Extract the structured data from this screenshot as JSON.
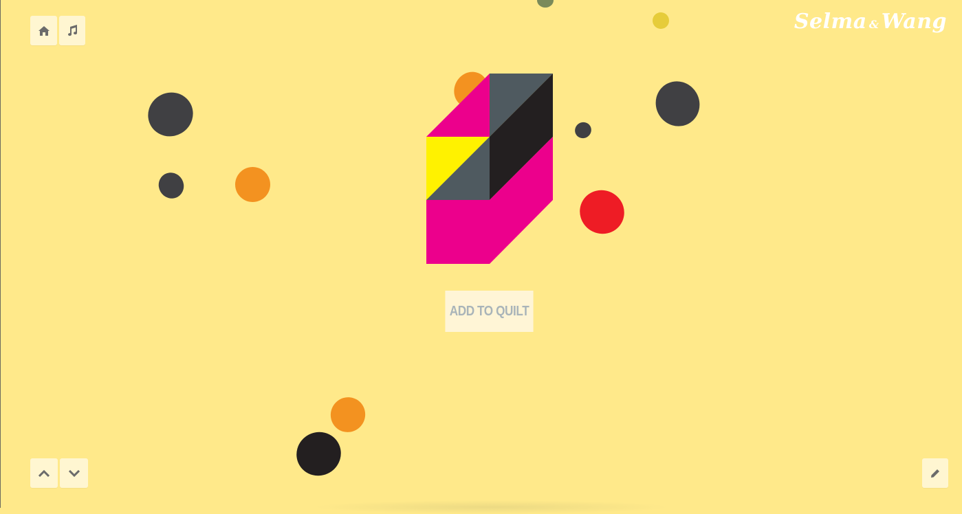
{
  "app": {
    "logo": {
      "left": "Selma",
      "amp": "&",
      "right": "Wang"
    }
  },
  "toolbar": {
    "home_icon": "home-icon",
    "music_icon": "music-note-icon"
  },
  "navigation": {
    "up_icon": "chevron-up-icon",
    "down_icon": "chevron-down-icon",
    "edit_icon": "pencil-icon"
  },
  "quilt_block": {
    "colors": {
      "magenta": "#ec008c",
      "slate": "#4f5a60",
      "charcoal": "#231f20",
      "yellow": "#fff200"
    }
  },
  "main": {
    "add_button_label": "ADD TO QUILT"
  },
  "palette": {
    "background": "#ffe98a",
    "dark_gray": "#404043",
    "orange": "#f39220",
    "red": "#ee1c25",
    "olive": "#7a8a5a",
    "mustard": "#e6cc3a"
  }
}
